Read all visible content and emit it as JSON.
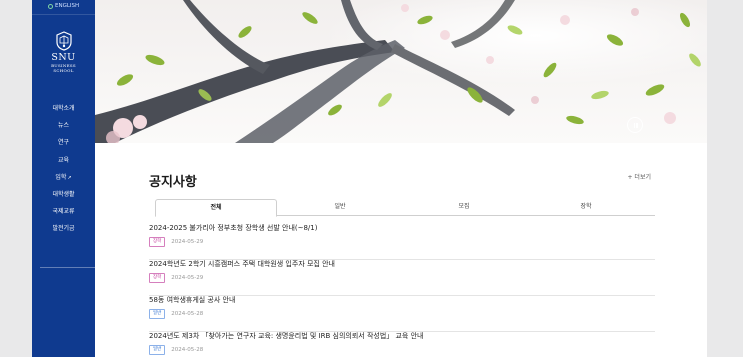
{
  "sidebar": {
    "lang": "ENGLISH",
    "logo": {
      "title": "SNU",
      "sub1": "BUSINESS",
      "sub2": "SCHOOL"
    },
    "menu": [
      "대학소개",
      "뉴스",
      "연구",
      "교육",
      "입학",
      "대학생활",
      "국제교류",
      "발전기금"
    ]
  },
  "notice": {
    "title": "공지사항",
    "more": "+ 더보기",
    "tabs": [
      "전체",
      "일반",
      "모집",
      "장학"
    ],
    "items": [
      {
        "title": "2024-2025 불가리아 정부초청 장학생 선발 안내(~8/1)",
        "badge": "장학",
        "date": "2024-05-29"
      },
      {
        "title": "2024학년도 2학기 시흥캠퍼스 주택 대학원생 입주자 모집 안내",
        "badge": "장학",
        "date": "2024-05-29"
      },
      {
        "title": "58동 여학생휴게실 공사 안내",
        "badge": "일반",
        "date": "2024-05-28"
      },
      {
        "title": "2024년도 제3차 「찾아가는 연구자 교육: 생명윤리법 및 IRB 심의의뢰서 작성법」 교육 안내",
        "badge": "일반",
        "date": "2024-05-28"
      }
    ]
  }
}
